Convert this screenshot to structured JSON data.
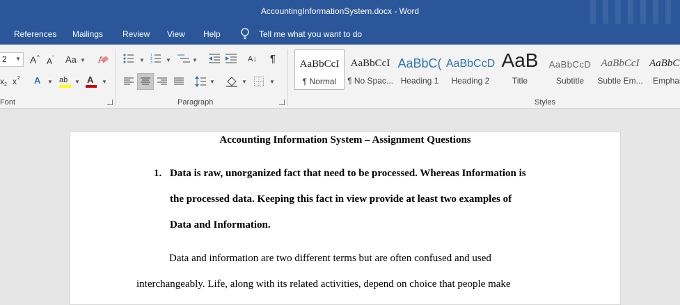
{
  "window": {
    "title": "AccountingInformationSystem.docx  -  Word"
  },
  "menu": {
    "items": [
      "References",
      "Mailings",
      "Review",
      "View",
      "Help"
    ],
    "tell_me": "Tell me what you want to do"
  },
  "ribbon": {
    "font_group": {
      "label": "Font",
      "size_value": "2"
    },
    "paragraph_group": {
      "label": "Paragraph"
    },
    "styles_group": {
      "label": "Styles",
      "items": [
        {
          "sample": "AaBbCcI",
          "name": "¶ Normal"
        },
        {
          "sample": "AaBbCcI",
          "name": "¶ No Spac..."
        },
        {
          "sample": "AaBbC(",
          "name": "Heading 1"
        },
        {
          "sample": "AaBbCcD",
          "name": "Heading 2"
        },
        {
          "sample": "AaB",
          "name": "Title"
        },
        {
          "sample": "AaBbCcD",
          "name": "Subtitle"
        },
        {
          "sample": "AaBbCcI",
          "name": "Subtle Em..."
        },
        {
          "sample": "AaBbC",
          "name": "Emphas"
        }
      ]
    },
    "glyphs": {
      "grow": "A",
      "shrink": "A",
      "case": "Aa",
      "clear": "A",
      "sub": "x",
      "sup": "x",
      "effects": "A",
      "highlight": "ab",
      "fontcolor": "A",
      "sort": "A↓",
      "pilcrow": "¶"
    }
  },
  "colors": {
    "titlebar": "#2b579a",
    "highlight_yellow": "#ffff00",
    "font_red": "#d00000",
    "heading_blue": "#2e74b5"
  },
  "document": {
    "title": "Accounting Information System – Assignment Questions",
    "question_number": "1.",
    "question_lines": [
      "Data is raw, unorganized fact that need to be processed. Whereas Information is",
      "the processed data. Keeping this fact in view provide at least two examples of",
      "Data and Information."
    ],
    "answer_lines": [
      "Data and information are two different terms but are often confused and used",
      "interchangeably. Life, along with its related activities, depend on choice that people make"
    ]
  }
}
